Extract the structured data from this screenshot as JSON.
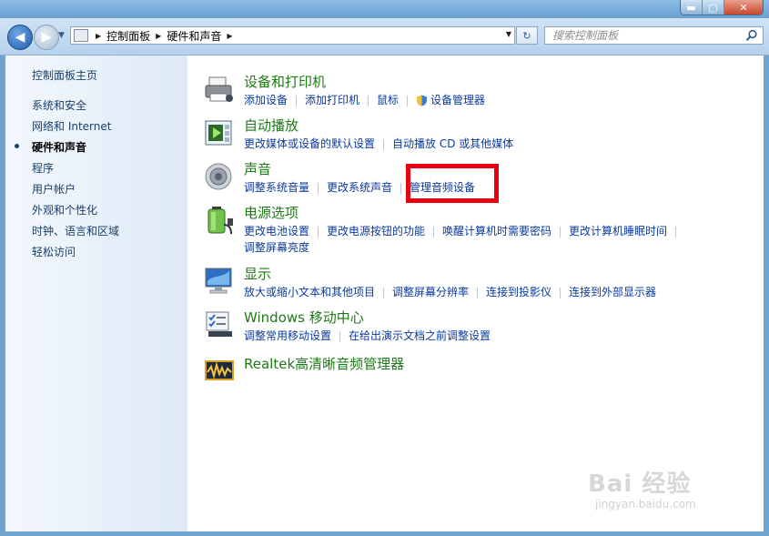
{
  "window": {
    "controls": {
      "minimize": "▬",
      "maximize": "▢",
      "close": "✕"
    }
  },
  "address_bar": {
    "breadcrumbs": [
      "控制面板",
      "硬件和声音"
    ],
    "search_placeholder": "搜索控制面板"
  },
  "sidebar": {
    "items": [
      {
        "label": "控制面板主页",
        "current": false
      },
      {
        "label": "系统和安全",
        "current": false
      },
      {
        "label": "网络和 Internet",
        "current": false
      },
      {
        "label": "硬件和声音",
        "current": true
      },
      {
        "label": "程序",
        "current": false
      },
      {
        "label": "用户帐户",
        "current": false
      },
      {
        "label": "外观和个性化",
        "current": false
      },
      {
        "label": "时钟、语言和区域",
        "current": false
      },
      {
        "label": "轻松访问",
        "current": false
      }
    ]
  },
  "categories": [
    {
      "title": "设备和打印机",
      "icon": "printer-icon",
      "links": [
        "添加设备",
        "添加打印机",
        "鼠标",
        "设备管理器"
      ]
    },
    {
      "title": "自动播放",
      "icon": "autoplay-icon",
      "links": [
        "更改媒体或设备的默认设置",
        "自动播放 CD 或其他媒体"
      ]
    },
    {
      "title": "声音",
      "icon": "speaker-icon",
      "links": [
        "调整系统音量",
        "更改系统声音",
        "管理音频设备"
      ]
    },
    {
      "title": "电源选项",
      "icon": "battery-icon",
      "links": [
        "更改电池设置",
        "更改电源按钮的功能",
        "唤醒计算机时需要密码",
        "更改计算机睡眠时间",
        "调整屏幕亮度"
      ]
    },
    {
      "title": "显示",
      "icon": "monitor-icon",
      "links": [
        "放大或缩小文本和其他项目",
        "调整屏幕分辨率",
        "连接到投影仪",
        "连接到外部显示器"
      ]
    },
    {
      "title": "Windows 移动中心",
      "icon": "mobility-center-icon",
      "links": [
        "调整常用移动设置",
        "在给出演示文档之前调整设置"
      ]
    },
    {
      "title": "Realtek高清晰音频管理器",
      "icon": "realtek-audio-icon",
      "links": []
    }
  ],
  "watermark": {
    "text": "Bai 经验",
    "sub": "jingyan.baidu.com"
  },
  "colors": {
    "highlight": "#e60012",
    "category_title": "#1e7a16",
    "link": "#0a3a9e"
  }
}
